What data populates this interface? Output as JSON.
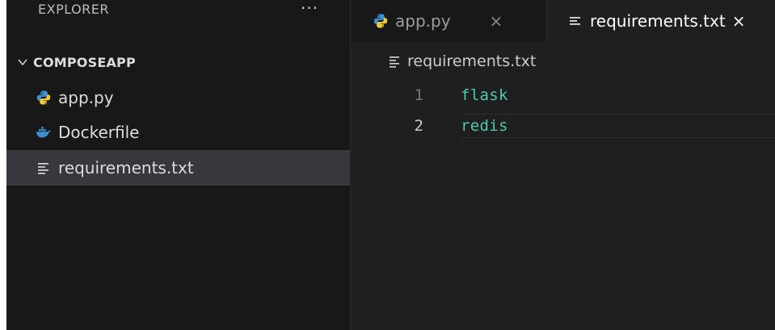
{
  "explorer": {
    "title": "EXPLORER",
    "more_label": "···",
    "folder": {
      "name": "COMPOSEAPP"
    },
    "files": [
      {
        "name": "app.py",
        "icon": "python-icon",
        "selected": false
      },
      {
        "name": "Dockerfile",
        "icon": "docker-icon",
        "selected": false
      },
      {
        "name": "requirements.txt",
        "icon": "text-lines-icon",
        "selected": true
      }
    ]
  },
  "tabs": [
    {
      "label": "app.py",
      "close": "×",
      "icon": "python-icon",
      "active": false
    },
    {
      "label": "requirements.txt",
      "close": "×",
      "icon": "text-lines-icon",
      "active": true
    }
  ],
  "breadcrumb": {
    "file": "requirements.txt",
    "icon": "text-lines-icon"
  },
  "editor": {
    "lines": [
      {
        "number": "1",
        "text": "flask"
      },
      {
        "number": "2",
        "text": "redis"
      }
    ],
    "current_line": 2
  },
  "colors": {
    "python_blue": "#3d8fd1",
    "python_yellow": "#f0c93a",
    "docker_blue": "#3d8fd1",
    "code_text": "#4ec9b0",
    "selected_row": "#37373d"
  }
}
